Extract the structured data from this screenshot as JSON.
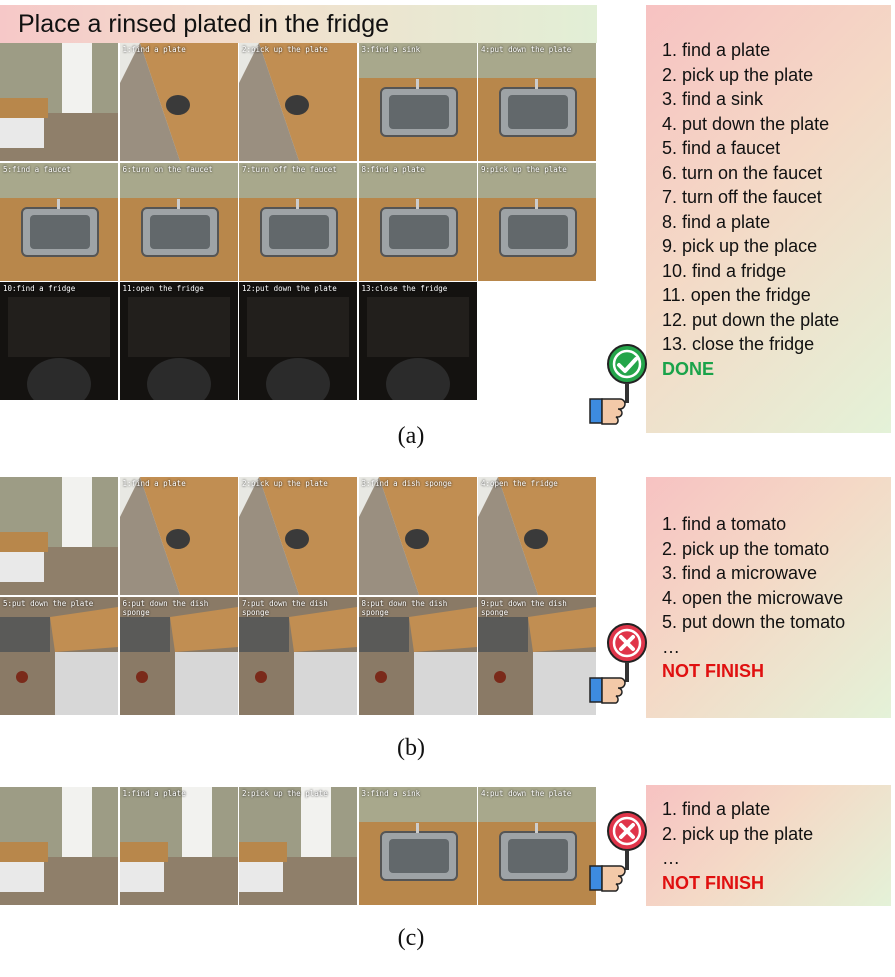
{
  "title": "Place a rinsed plated in the fridge",
  "panels": [
    {
      "caption": "(a)",
      "frames": [
        {
          "label": "",
          "kind": "room"
        },
        {
          "label": "1:find a plate",
          "kind": "counter"
        },
        {
          "label": "2:pick up the plate",
          "kind": "counter"
        },
        {
          "label": "3:find a sink",
          "kind": "sink"
        },
        {
          "label": "4:put down the plate",
          "kind": "sink"
        },
        {
          "label": "5:find a faucet",
          "kind": "sink"
        },
        {
          "label": "6:turn on the faucet",
          "kind": "sink"
        },
        {
          "label": "7:turn off the faucet",
          "kind": "sink"
        },
        {
          "label": "8:find a plate",
          "kind": "sink"
        },
        {
          "label": "9:pick up the plate",
          "kind": "sink"
        },
        {
          "label": "10:find a fridge",
          "kind": "dark"
        },
        {
          "label": "11:open the fridge",
          "kind": "dark"
        },
        {
          "label": "12:put down the plate",
          "kind": "dark"
        },
        {
          "label": "13:close the fridge",
          "kind": "dark"
        }
      ],
      "steps": [
        "1. find a plate",
        "2. pick up the plate",
        "3. find a sink",
        "4. put down the plate",
        "5. find a faucet",
        "6. turn on the faucet",
        "7. turn off the faucet",
        "8. find a plate",
        "9. pick up the place",
        "10. find a fridge",
        "11. open the fridge",
        "12. put down the plate",
        "13. close the fridge"
      ],
      "status": "DONE",
      "status_color": "#1aa34a",
      "badge": "check-icon"
    },
    {
      "caption": "(b)",
      "frames": [
        {
          "label": "",
          "kind": "room"
        },
        {
          "label": "1:find a plate",
          "kind": "counter"
        },
        {
          "label": "2:pick up the plate",
          "kind": "counter"
        },
        {
          "label": "3:find a dish sponge",
          "kind": "counter"
        },
        {
          "label": "4:open the fridge",
          "kind": "counter"
        },
        {
          "label": "5:put down the plate",
          "kind": "floor"
        },
        {
          "label": "6:put down the dish sponge",
          "kind": "floor"
        },
        {
          "label": "7:put down the dish sponge",
          "kind": "floor"
        },
        {
          "label": "8:put down the dish sponge",
          "kind": "floor"
        },
        {
          "label": "9:put down the dish sponge",
          "kind": "floor"
        }
      ],
      "steps": [
        "1. find a tomato",
        "2. pick up the tomato",
        "3. find a microwave",
        "4. open the microwave",
        "5. put down the tomato",
        "…"
      ],
      "status": "NOT FINISH",
      "status_color": "#e01010",
      "badge": "cross-icon"
    },
    {
      "caption": "(c)",
      "frames": [
        {
          "label": "",
          "kind": "room"
        },
        {
          "label": "1:find a plate",
          "kind": "room"
        },
        {
          "label": "2:pick up the plate",
          "kind": "room"
        },
        {
          "label": "3:find a sink",
          "kind": "sink2"
        },
        {
          "label": "4:put down the plate",
          "kind": "sink2"
        }
      ],
      "steps": [
        "1. find a plate",
        "2. pick up the plate",
        "…"
      ],
      "status": "NOT FINISH",
      "status_color": "#e01010",
      "badge": "cross-icon"
    }
  ]
}
